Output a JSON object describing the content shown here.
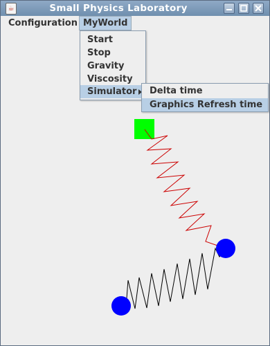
{
  "window": {
    "title": "Small Physics Laboratory",
    "icon": "java-cup-icon"
  },
  "menubar": {
    "items": [
      "Configuration",
      "MyWorld"
    ],
    "active": "MyWorld"
  },
  "myworld_menu": {
    "items": [
      "Start",
      "Stop",
      "Gravity",
      "Viscosity",
      "Simulator"
    ],
    "selected": "Simulator"
  },
  "simulator_submenu": {
    "items": [
      "Delta time",
      "Graphics Refresh time"
    ],
    "selected": "Graphics Refresh time"
  },
  "simulation": {
    "fixed_block": {
      "color": "#00ff00"
    },
    "balls": {
      "color": "#0000ff"
    },
    "springs": [
      {
        "color": "#cc0000"
      },
      {
        "color": "#000000"
      }
    ]
  }
}
